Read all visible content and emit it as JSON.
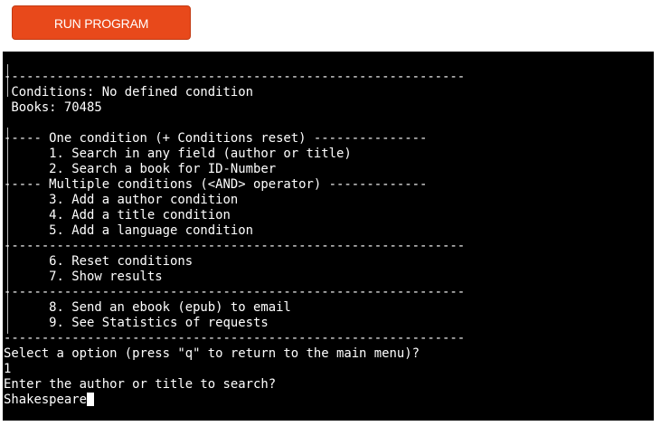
{
  "toolbar": {
    "run_label": "RUN PROGRAM",
    "run_color": "#e8491b"
  },
  "terminal": {
    "lines": [
      "-------------------------------------------------------------",
      " Conditions: No defined condition",
      " Books: 70485",
      "",
      "----- One condition (+ Conditions reset) ---------------",
      "      1. Search in any field (author or title)",
      "      2. Search a book for ID-Number",
      "----- Multiple conditions (<AND> operator) -------------",
      "      3. Add a author condition",
      "      4. Add a title condition",
      "      5. Add a language condition",
      "-------------------------------------------------------------",
      "      6. Reset conditions",
      "      7. Show results",
      "-------------------------------------------------------------",
      "      8. Send an ebook (epub) to email",
      "      9. See Statistics of requests",
      "-------------------------------------------------------------",
      "Select a option (press \"q\" to return to the main menu)?",
      "1",
      "Enter the author or title to search?"
    ],
    "input_value": "Shakespeare",
    "background": "#000000",
    "text_color": "#ffffff"
  }
}
